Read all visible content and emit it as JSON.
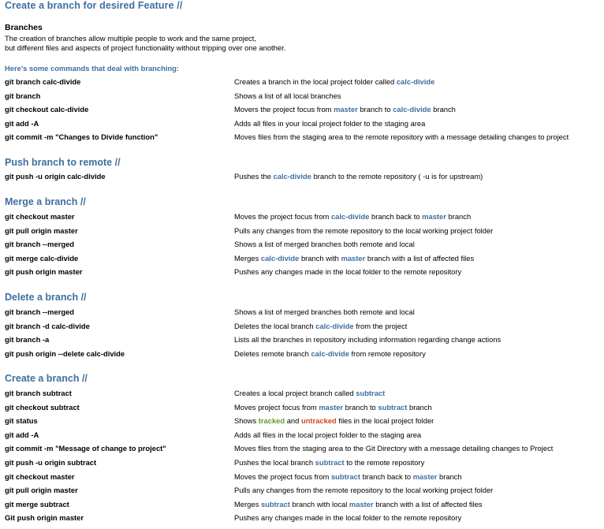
{
  "title": "Create a branch for desired Feature //",
  "intro": {
    "heading": "Branches",
    "lines": [
      "The creation of branches allow multiple people to work and the same project,",
      "but different files and aspects of project functionality without tripping over one another."
    ],
    "subheading": "Here's some commands that deal with branching:"
  },
  "colors": {
    "heading": "#3f6f9f",
    "tracked": "#5a9a2c",
    "untracked": "#d24a16"
  },
  "sections": [
    {
      "rows": [
        {
          "cmd": "git branch calc-divide",
          "desc": [
            {
              "t": "Creates a branch in the local project folder called "
            },
            {
              "t": "calc-divide",
              "c": "blue"
            }
          ]
        },
        {
          "cmd": "git branch",
          "desc": [
            {
              "t": "Shows a list of all local branches"
            }
          ]
        },
        {
          "cmd": "git checkout calc-divide",
          "desc": [
            {
              "t": "Movers the project focus from "
            },
            {
              "t": "master",
              "c": "blue"
            },
            {
              "t": " branch to "
            },
            {
              "t": "calc-divide",
              "c": "blue"
            },
            {
              "t": " branch"
            }
          ]
        },
        {
          "cmd": "git add -A",
          "desc": [
            {
              "t": "Adds all files in your local project folder to the staging area"
            }
          ]
        },
        {
          "cmd": "git commit -m \"Changes to Divide function\"",
          "desc": [
            {
              "t": "Moves files from the staging area to the remote repository with a message detailing changes to project"
            }
          ]
        }
      ]
    },
    {
      "heading": "Push branch to remote //",
      "rows": [
        {
          "cmd": "git push -u origin calc-divide",
          "desc": [
            {
              "t": "Pushes the "
            },
            {
              "t": "calc-divide",
              "c": "blue"
            },
            {
              "t": " branch to the remote repository ( -u is for upstream)"
            }
          ]
        }
      ]
    },
    {
      "heading": "Merge a branch //",
      "rows": [
        {
          "cmd": "git checkout master",
          "desc": [
            {
              "t": "Moves the project focus from "
            },
            {
              "t": "calc-divide",
              "c": "blue"
            },
            {
              "t": " branch back to "
            },
            {
              "t": "master",
              "c": "blue"
            },
            {
              "t": " branch"
            }
          ]
        },
        {
          "cmd": "git pull origin master",
          "desc": [
            {
              "t": "Pulls any changes from the remote repository to the local working project folder"
            }
          ]
        },
        {
          "cmd": "git branch --merged",
          "desc": [
            {
              "t": "Shows a list of merged branches both remote and local"
            }
          ]
        },
        {
          "cmd": "git merge calc-divide",
          "desc": [
            {
              "t": "Merges "
            },
            {
              "t": "calc-divide",
              "c": "blue"
            },
            {
              "t": " branch with "
            },
            {
              "t": "master",
              "c": "blue"
            },
            {
              "t": " branch with a list of affected files"
            }
          ]
        },
        {
          "cmd": "git push origin master",
          "desc": [
            {
              "t": "Pushes any changes made in the local folder to the remote repository"
            }
          ]
        }
      ]
    },
    {
      "heading": "Delete a branch //",
      "rows": [
        {
          "cmd": "git branch --merged",
          "desc": [
            {
              "t": "Shows a list of merged branches both remote and local"
            }
          ]
        },
        {
          "cmd": "git branch -d calc-divide",
          "desc": [
            {
              "t": "Deletes the local branch "
            },
            {
              "t": "calc-divide",
              "c": "blue"
            },
            {
              "t": " from the project"
            }
          ]
        },
        {
          "cmd": "git branch -a",
          "desc": [
            {
              "t": "Lists all the branches in repository including information regarding change actions"
            }
          ]
        },
        {
          "cmd": "git push origin --delete calc-divide",
          "desc": [
            {
              "t": "Deletes remote branch "
            },
            {
              "t": "calc-divide",
              "c": "blue"
            },
            {
              "t": " from remote repository"
            }
          ]
        }
      ]
    },
    {
      "heading": "Create a branch //",
      "rows": [
        {
          "cmd": "git branch subtract",
          "desc": [
            {
              "t": "Creates a local project branch called "
            },
            {
              "t": "subtract",
              "c": "blue"
            }
          ]
        },
        {
          "cmd": "git checkout subtract",
          "desc": [
            {
              "t": "Moves project focus from "
            },
            {
              "t": "master",
              "c": "blue"
            },
            {
              "t": " branch to "
            },
            {
              "t": "subtract",
              "c": "blue"
            },
            {
              "t": " branch"
            }
          ]
        },
        {
          "cmd": "git status",
          "desc": [
            {
              "t": "Shows "
            },
            {
              "t": "tracked",
              "c": "green"
            },
            {
              "t": " and "
            },
            {
              "t": "untracked",
              "c": "red"
            },
            {
              "t": " files in the local project folder"
            }
          ]
        },
        {
          "cmd": "git add -A",
          "desc": [
            {
              "t": "Adds all files in the local project folder to the staging area"
            }
          ]
        },
        {
          "cmd": "git commit -m \"Message of change to project\"",
          "desc": [
            {
              "t": "Moves files from the staging area to the Git Directory with a message detailing changes to Project"
            }
          ]
        },
        {
          "cmd": "git push -u origin subtract",
          "desc": [
            {
              "t": "Pushes the local branch "
            },
            {
              "t": "subtract",
              "c": "blue"
            },
            {
              "t": " to the remote repository"
            }
          ]
        },
        {
          "cmd": "git checkout master",
          "desc": [
            {
              "t": "Moves the project focus from "
            },
            {
              "t": "subtract",
              "c": "blue"
            },
            {
              "t": " branch back to "
            },
            {
              "t": "master",
              "c": "blue"
            },
            {
              "t": " branch"
            }
          ]
        },
        {
          "cmd": "git pull origin master",
          "desc": [
            {
              "t": "Pulls any changes from the remote repository to the local working project folder"
            }
          ]
        },
        {
          "cmd": "git merge subtract",
          "desc": [
            {
              "t": "Merges "
            },
            {
              "t": "subtract",
              "c": "blue"
            },
            {
              "t": " branch with local "
            },
            {
              "t": "master",
              "c": "blue"
            },
            {
              "t": " branch with a list of affected files"
            }
          ]
        },
        {
          "cmd": "Git push origin master",
          "desc": [
            {
              "t": "Pushes any changes made in the local folder to the remote repository"
            }
          ]
        }
      ]
    }
  ]
}
